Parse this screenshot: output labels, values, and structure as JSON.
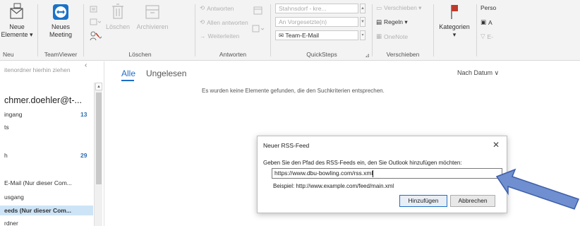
{
  "ribbon": {
    "neu": {
      "new_items_label_1": "Neue",
      "new_items_label_2": "Elemente ▾",
      "group_label": "Neu"
    },
    "teamviewer": {
      "meeting_label_1": "Neues",
      "meeting_label_2": "Meeting",
      "group_label": "TeamViewer"
    },
    "loeschen": {
      "delete_label": "Löschen",
      "archive_label": "Archivieren",
      "group_label": "Löschen"
    },
    "antworten": {
      "reply_label": "Antworten",
      "reply_all_label": "Allen antworten",
      "forward_label": "Weiterleiten",
      "group_label": "Antworten"
    },
    "quicksteps": {
      "items": [
        "Stahnsdorf - kre...",
        "An Vorgesetzte(n)",
        "Team-E-Mail"
      ],
      "group_label": "QuickSteps",
      "launcher": "⊿"
    },
    "verschieben": {
      "move_label": "Verschieben ▾",
      "rules_label": "Regeln ▾",
      "onenote_label": "OneNote",
      "group_label": "Verschieben"
    },
    "kategorien": {
      "label": "Kategorien",
      "dropdown": "▾"
    },
    "person": {
      "label": "Perso",
      "a_label": "A",
      "e_label": "E-"
    }
  },
  "folder_pane": {
    "favorites_hint": "itenordner hierhin ziehen",
    "collapse_glyph": "‹",
    "account": "chmer.doehler@t-...",
    "folders": [
      {
        "label": "ingang",
        "count": "13",
        "bold": false
      },
      {
        "label": "ts",
        "count": "",
        "bold": false
      },
      {
        "label": "h",
        "count": "29",
        "bold": false
      },
      {
        "label": "E-Mail (Nur dieser Com...",
        "count": "",
        "bold": false
      },
      {
        "label": "usgang",
        "count": "",
        "bold": false
      },
      {
        "label": "eeds (Nur dieser Com...",
        "count": "",
        "bold": true
      },
      {
        "label": "rdner",
        "count": "",
        "bold": false
      }
    ]
  },
  "message_list": {
    "tab_all": "Alle",
    "tab_unread": "Ungelesen",
    "sort_label": "Nach Datum ∨",
    "empty_message": "Es wurden keine Elemente gefunden, die den Suchkriterien entsprechen."
  },
  "dialog": {
    "title": "Neuer RSS-Feed",
    "close_glyph": "✕",
    "prompt": "Geben Sie den Pfad des RSS-Feeds ein, den Sie Outlook hinzufügen möchten:",
    "url_value": "https://www.dbu-bowling.com/rss.xml",
    "example": "Beispiel: http://www.example.com/feed/main.xml",
    "add_button": "Hinzufügen",
    "cancel_button": "Abbrechen"
  },
  "colors": {
    "accent": "#1f6ec7",
    "arrow_fill": "#6f8fd0"
  },
  "icons": [
    "new-items-icon",
    "teamviewer-icon",
    "delete-icon",
    "archive-icon",
    "reply-icon",
    "reply-all-icon",
    "forward-icon",
    "move-icon",
    "rules-icon",
    "onenote-icon",
    "category-flag-icon",
    "close-icon",
    "scroll-up-icon",
    "annotation-arrow-icon"
  ]
}
